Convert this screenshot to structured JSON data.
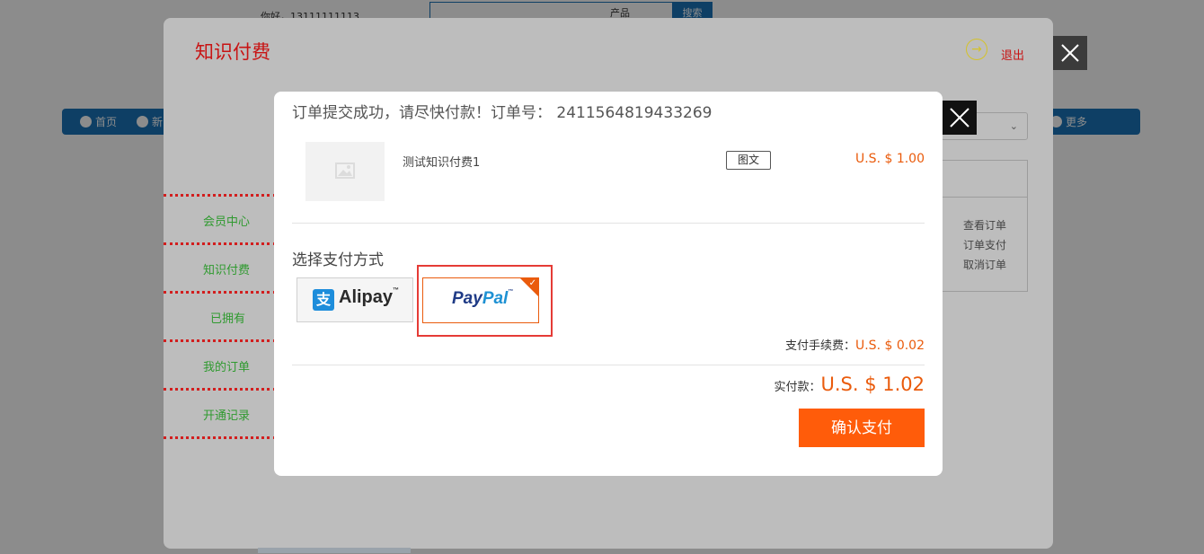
{
  "background_page": {
    "greeting": "你好，13111111113",
    "search_select": "产品",
    "search_button": "搜索",
    "nav": [
      "首页",
      "新",
      "更多"
    ]
  },
  "outer_modal": {
    "title": "知识付费",
    "logout_label": "退出",
    "table_links": [
      "查看订单",
      "订单支付",
      "取消订单"
    ],
    "side_menu": [
      "会员中心",
      "知识付费",
      "已拥有",
      "我的订单",
      "开通记录"
    ]
  },
  "inner_modal": {
    "order_message": "订单提交成功，请尽快付款！订单号： 2411564819433269",
    "product": {
      "name": "测试知识付费1",
      "tag": "图文",
      "price": "U.S. $ 1.00"
    },
    "payment_section_title": "选择支付方式",
    "payment_methods": [
      {
        "name": "Alipay",
        "selected": false
      },
      {
        "name": "PayPal",
        "selected": true
      }
    ],
    "fee_label": "支付手续费：",
    "fee_value": "U.S. $ 0.02",
    "total_label": "实付款：",
    "total_value": "U.S. $ 1.02",
    "confirm_button": "确认支付"
  },
  "colors": {
    "accent_orange": "#ff5c0a",
    "title_red": "#c81414",
    "menu_green": "#2f9a2f",
    "highlight_red": "#e53b36"
  }
}
